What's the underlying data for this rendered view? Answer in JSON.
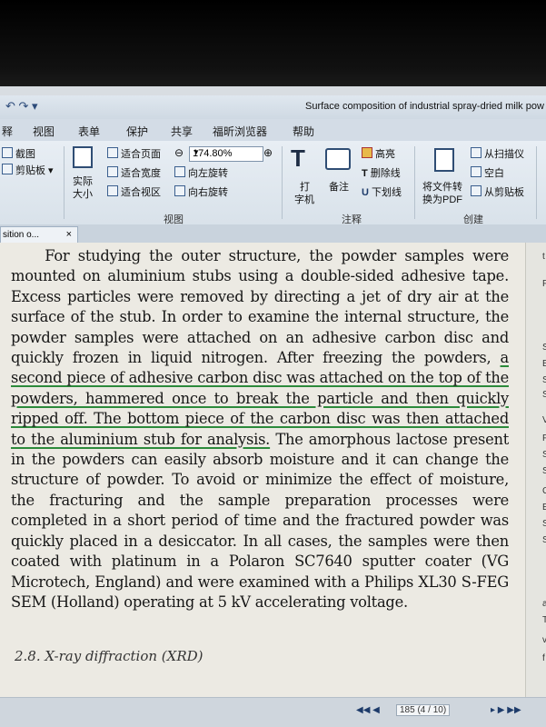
{
  "window": {
    "title": "Surface composition of industrial spray-dried milk pow",
    "quick_access": "↶ ↷ ▾"
  },
  "menu": [
    "释",
    "视图",
    "表单",
    "保护",
    "共享",
    "福昕浏览器",
    "帮助"
  ],
  "ribbon": {
    "clip_screenshot": "截图",
    "clipboard": "剪贴板 ▾",
    "actual_size": "实际",
    "actual_size2": "大小",
    "fit_page": "适合页面",
    "fit_width": "适合宽度",
    "fit_visible": "适合视区",
    "zoom_value": "174.80%",
    "rotate_left": "向左旋转",
    "rotate_right": "向右旋转",
    "group_view": "视图",
    "typewriter": "打",
    "typewriter2": "字机",
    "note": "备注",
    "highlight": "高亮",
    "strikeout": "删除线",
    "underline": "下划线",
    "group_annot": "注释",
    "convert_pdf": "将文件转",
    "convert_pdf2": "换为PDF",
    "from_scanner": "从扫描仪",
    "blank": "空白",
    "from_clipboard": "从剪贴板",
    "group_create": "创建"
  },
  "tab": {
    "label": "sition o...",
    "close": "×"
  },
  "document": {
    "p1": "For studying the outer structure, the powder samples were mounted on aluminium stubs using a double-sided adhesive tape. Excess particles were removed by directing a jet of dry air at the surface of the stub. In order to examine the internal structure, the powder samples were attached on an adhesive carbon disc and quickly frozen in liquid nitrogen. After freezing the powders,",
    "highlighted": "a second piece of adhesive carbon disc was attached on the top of the powders, hammered once to break the particle and then quickly ripped off. The bottom piece of the carbon disc was then attached to the aluminium stub for analysis.",
    "p2": "The amorphous lactose present in the powders can easily absorb moisture and it can change the structure of powder. To avoid or minimize the effect of moisture, the fracturing and the sample preparation processes were completed in a short period of time and the fractured powder was quickly placed in a desiccator. In all cases, the samples were then coated with platinum in a Polaron SC7640 sputter coater (VG Microtech, England) and were examined with a Philips XL30 S-FEG SEM (Holland) operating at 5 kV accelerating voltage.",
    "section_heading": "2.8. X-ray diffraction (XRD)"
  },
  "side_chars": [
    "t",
    "P",
    "S",
    "B",
    "S",
    "S",
    "V",
    "F",
    "S",
    "S",
    "C",
    "E",
    "S",
    "S",
    "a",
    "T",
    "v",
    "f"
  ],
  "status": {
    "prev": "◀◀ ◀",
    "page": "185 (4 / 10)",
    "next": "▸ ▶ ▶▶"
  }
}
